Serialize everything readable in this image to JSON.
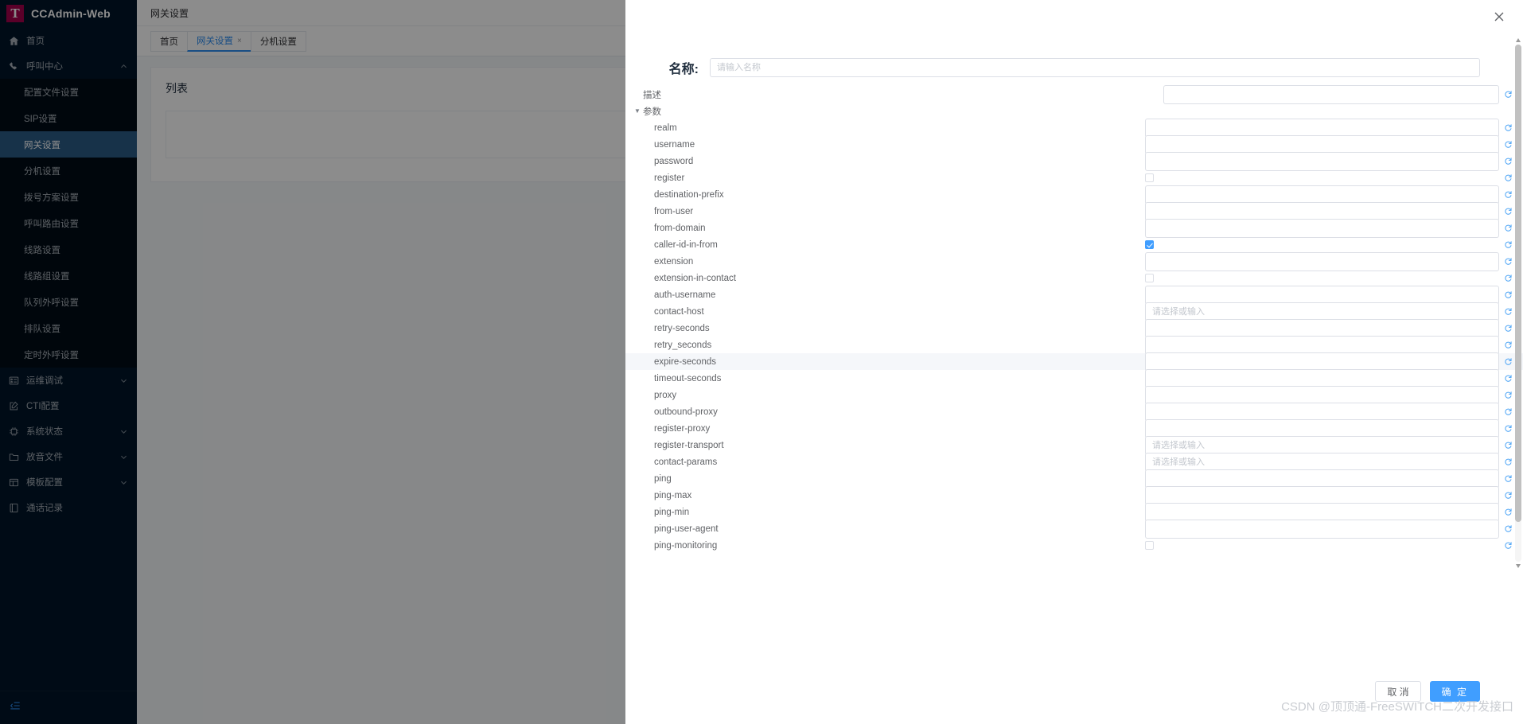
{
  "brand": {
    "logo_letter": "T",
    "name": "CCAdmin-Web"
  },
  "sidebar": {
    "items": [
      {
        "label": "首页",
        "icon": "home-icon",
        "expandable": false
      },
      {
        "label": "呼叫中心",
        "icon": "phone-icon",
        "expandable": true,
        "expanded": true
      },
      {
        "label": "运维调试",
        "icon": "terminal-icon",
        "expandable": true,
        "expanded": false
      },
      {
        "label": "CTI配置",
        "icon": "edit-square-icon",
        "expandable": false
      },
      {
        "label": "系统状态",
        "icon": "chip-icon",
        "expandable": true,
        "expanded": false
      },
      {
        "label": "放音文件",
        "icon": "folder-icon",
        "expandable": true,
        "expanded": false
      },
      {
        "label": "模板配置",
        "icon": "layout-icon",
        "expandable": true,
        "expanded": false
      },
      {
        "label": "通话记录",
        "icon": "book-icon",
        "expandable": false
      }
    ],
    "call_center_children": [
      {
        "label": "配置文件设置",
        "active": false
      },
      {
        "label": "SIP设置",
        "active": false
      },
      {
        "label": "网关设置",
        "active": true
      },
      {
        "label": "分机设置",
        "active": false
      },
      {
        "label": "拨号方案设置",
        "active": false
      },
      {
        "label": "呼叫路由设置",
        "active": false
      },
      {
        "label": "线路设置",
        "active": false
      },
      {
        "label": "线路组设置",
        "active": false
      },
      {
        "label": "队列外呼设置",
        "active": false
      },
      {
        "label": "排队设置",
        "active": false
      },
      {
        "label": "定时外呼设置",
        "active": false
      }
    ],
    "collapse_icon": "collapse-menu-icon"
  },
  "topbar": {
    "title": "网关设置"
  },
  "tabs": [
    {
      "label": "首页",
      "active": false,
      "closable": false
    },
    {
      "label": "网关设置",
      "active": true,
      "closable": true,
      "close_glyph": "×"
    },
    {
      "label": "分机设置",
      "active": false,
      "closable": false
    }
  ],
  "content": {
    "card_title": "列表"
  },
  "dialog": {
    "close_icon": "close-icon",
    "name_label": "名称:",
    "name_placeholder": "请输入名称",
    "name_value": "",
    "description_label": "描述",
    "params_group_label": "参数",
    "select_placeholder": "请选择或输入",
    "reset_icon": "refresh-reset-icon",
    "fields": [
      {
        "label": "realm",
        "type": "text",
        "value": "",
        "placeholder": "",
        "reset": true
      },
      {
        "label": "username",
        "type": "text",
        "value": "",
        "placeholder": "",
        "reset": true
      },
      {
        "label": "password",
        "type": "text",
        "value": "",
        "placeholder": "",
        "reset": true
      },
      {
        "label": "register",
        "type": "checkbox",
        "checked": false,
        "reset": true
      },
      {
        "label": "destination-prefix",
        "type": "text",
        "value": "",
        "placeholder": "",
        "reset": true
      },
      {
        "label": "from-user",
        "type": "text",
        "value": "",
        "placeholder": "",
        "reset": true
      },
      {
        "label": "from-domain",
        "type": "text",
        "value": "",
        "placeholder": "",
        "reset": true
      },
      {
        "label": "caller-id-in-from",
        "type": "checkbox",
        "checked": true,
        "reset": true
      },
      {
        "label": "extension",
        "type": "text",
        "value": "",
        "placeholder": "",
        "reset": true
      },
      {
        "label": "extension-in-contact",
        "type": "checkbox",
        "checked": false,
        "reset": true
      },
      {
        "label": "auth-username",
        "type": "text",
        "value": "",
        "placeholder": "",
        "reset": true
      },
      {
        "label": "contact-host",
        "type": "select",
        "value": "",
        "placeholder": "请选择或输入",
        "reset": true
      },
      {
        "label": "retry-seconds",
        "type": "text",
        "value": "",
        "placeholder": "",
        "reset": true
      },
      {
        "label": "retry_seconds",
        "type": "text",
        "value": "",
        "placeholder": "",
        "reset": true
      },
      {
        "label": "expire-seconds",
        "type": "text",
        "value": "",
        "placeholder": "",
        "reset": true,
        "highlight": true
      },
      {
        "label": "timeout-seconds",
        "type": "text",
        "value": "",
        "placeholder": "",
        "reset": true
      },
      {
        "label": "proxy",
        "type": "text",
        "value": "",
        "placeholder": "",
        "reset": true
      },
      {
        "label": "outbound-proxy",
        "type": "text",
        "value": "",
        "placeholder": "",
        "reset": true
      },
      {
        "label": "register-proxy",
        "type": "text",
        "value": "",
        "placeholder": "",
        "reset": true
      },
      {
        "label": "register-transport",
        "type": "select",
        "value": "",
        "placeholder": "请选择或输入",
        "reset": true
      },
      {
        "label": "contact-params",
        "type": "select",
        "value": "",
        "placeholder": "请选择或输入",
        "reset": true
      },
      {
        "label": "ping",
        "type": "text",
        "value": "",
        "placeholder": "",
        "reset": true
      },
      {
        "label": "ping-max",
        "type": "text",
        "value": "",
        "placeholder": "",
        "reset": true
      },
      {
        "label": "ping-min",
        "type": "text",
        "value": "",
        "placeholder": "",
        "reset": true
      },
      {
        "label": "ping-user-agent",
        "type": "text",
        "value": "",
        "placeholder": "",
        "reset": true
      },
      {
        "label": "ping-monitoring",
        "type": "checkbox",
        "checked": false,
        "reset": true
      }
    ],
    "cancel_label": "取 消",
    "confirm_label": "确 定"
  },
  "watermark": "CSDN @顶顶通-FreeSWITCH二次开发接口",
  "colors": {
    "sidebar_bg": "#001529",
    "submenu_bg": "#000c17",
    "active_item": "#2b5b86",
    "brand_logo": "#a4004b",
    "primary": "#409eff",
    "tab_active": "#2d8cf0",
    "reset_icon": "#49a2f5"
  }
}
